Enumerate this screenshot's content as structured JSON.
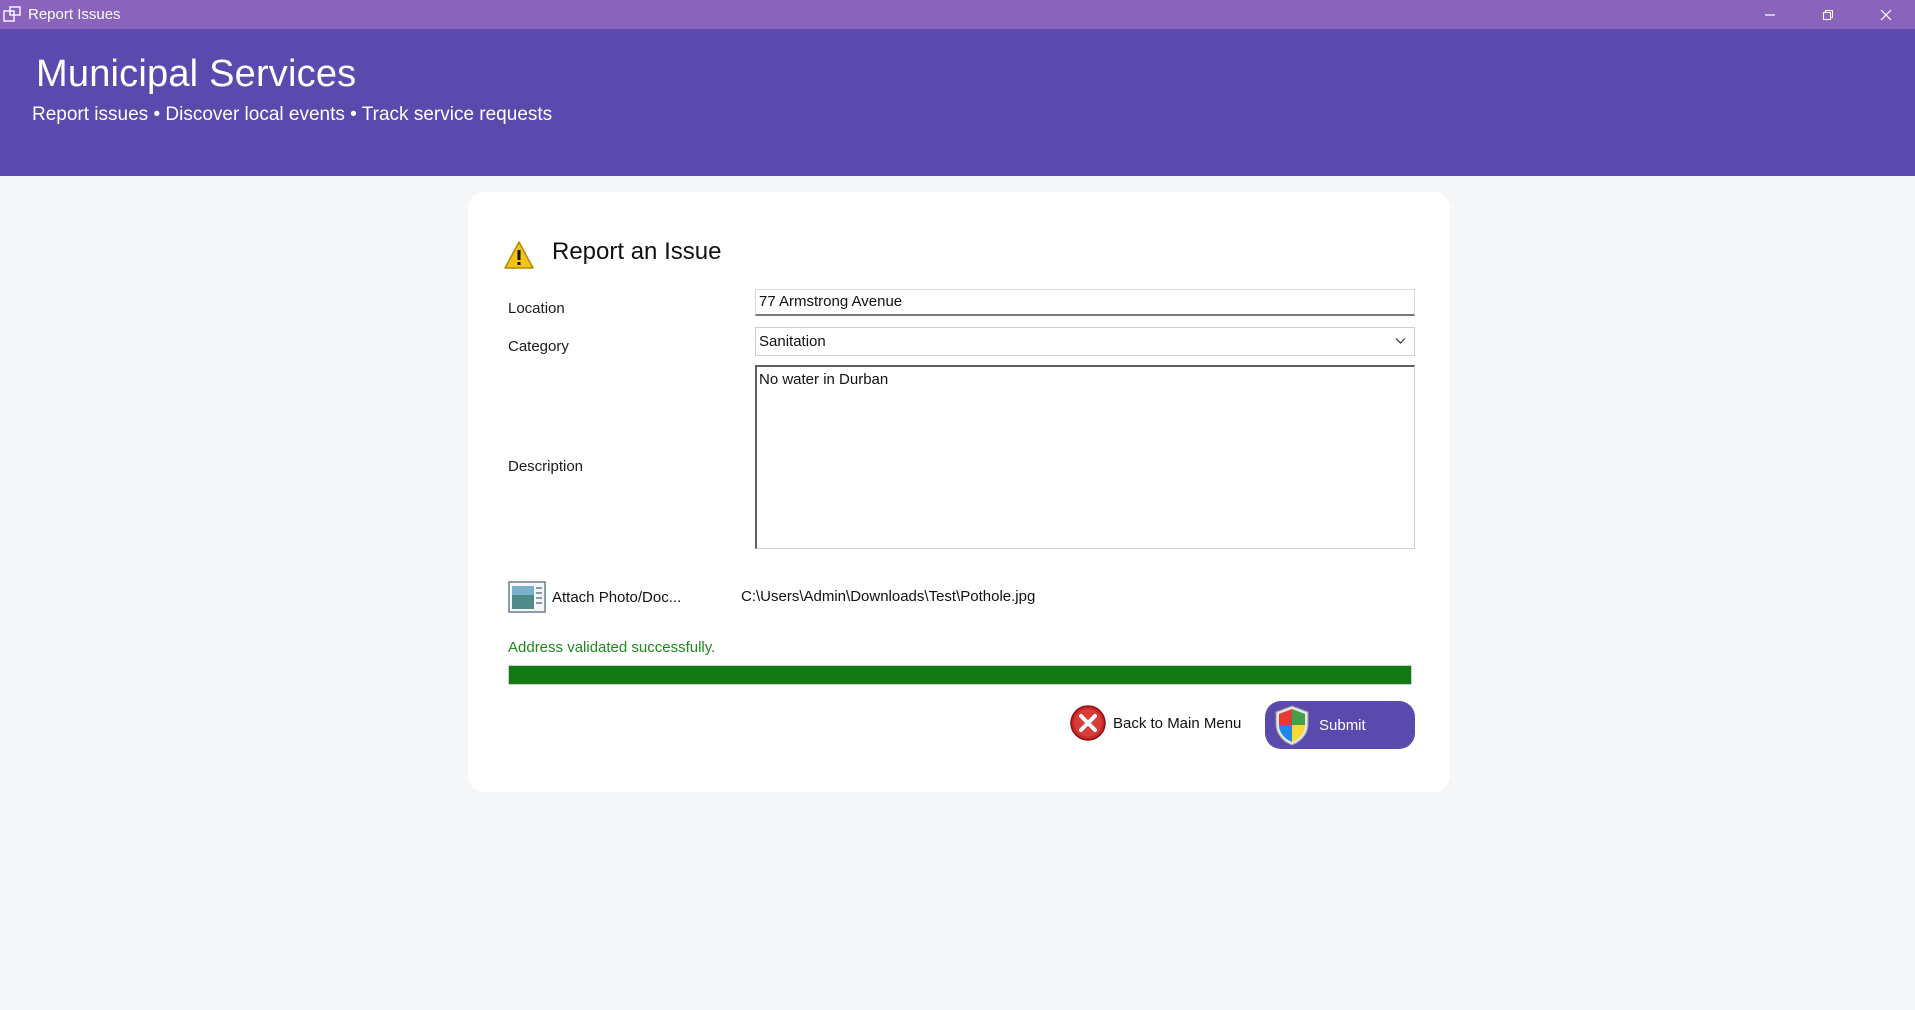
{
  "window": {
    "title": "Report Issues",
    "icons": {
      "app": "app-window-icon",
      "minimize": "minimize-icon",
      "maximize": "restore-icon",
      "close": "close-icon"
    }
  },
  "header": {
    "title": "Municipal Services",
    "subtitle": "Report issues • Discover local events • Track service requests",
    "background": "#5b4aae"
  },
  "form": {
    "title": "Report an Issue",
    "title_icon": "warning-icon",
    "location": {
      "label": "Location",
      "value": "77 Armstrong Avenue"
    },
    "category": {
      "label": "Category",
      "selected": "Sanitation"
    },
    "description": {
      "label": "Description",
      "value": "No water in Durban"
    },
    "attach": {
      "label": "Attach Photo/Doc...",
      "icon": "document-image-icon",
      "file_path": "C:\\Users\\Admin\\Downloads\\Test\\Pothole.jpg"
    },
    "status": {
      "message": "Address validated successfully.",
      "color": "#1b8a1b"
    },
    "progress": {
      "value_percent": 100,
      "color": "#127a12"
    },
    "buttons": {
      "back": {
        "label": "Back to Main Menu",
        "icon": "red-x-icon"
      },
      "submit": {
        "label": "Submit",
        "icon": "shield-icon"
      }
    }
  }
}
